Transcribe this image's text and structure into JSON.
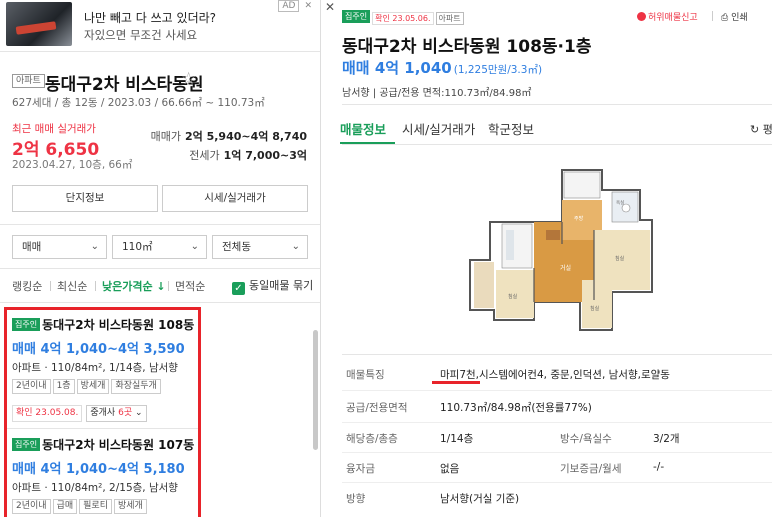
{
  "ad": {
    "line1": "나만 빼고 다 쓰고 있더라?",
    "line2": "자있으면 무조건 사세요",
    "badge": "AD",
    "close": "✕"
  },
  "complex": {
    "type": "아파트",
    "name": "동대구2차 비스타동원",
    "meta": "627세대 / 총 12동 / 2023.03 / 66.66㎡ ~ 110.73㎡",
    "recent_label": "최근 매매 실거래가",
    "recent_price": "2억 6,650",
    "recent_date": "2023.04.27, 10층, 66㎡",
    "sale_label": "매매가",
    "sale_range": "2억 5,940~4억 8,740",
    "jeonse_label": "전세가",
    "jeonse_range": "1억 7,000~3억",
    "btn_info": "단지정보",
    "btn_trade": "시세/실거래가"
  },
  "filters": {
    "deal": "매매",
    "area": "110㎡",
    "dong": "전체동"
  },
  "sort": {
    "ranking": "랭킹순",
    "newest": "최신순",
    "lowest": "낮은가격순 ↓",
    "area": "면적순",
    "group_same": "동일매물 묶기"
  },
  "listings": [
    {
      "badge": "집주인",
      "title": "동대구2차 비스타동원 108동",
      "price": "매매 4억 1,040~4억 3,590",
      "spec": "아파트 · 110/84m², 1/14층, 남서향",
      "tags": [
        "2년이내",
        "1층",
        "방세개",
        "화장실두개"
      ],
      "confirm": "확인 23.05.08.",
      "agent_label": "중개사",
      "agent_count": "6곳"
    },
    {
      "badge": "집주인",
      "title": "동대구2차 비스타동원 107동",
      "price": "매매 4억 1,040~4억 5,180",
      "spec": "아파트 · 110/84m², 2/15층, 남서향",
      "tags": [
        "2년이내",
        "급매",
        "필로티",
        "방세개"
      ]
    }
  ],
  "detail": {
    "badge_owner": "집주인",
    "badge_confirm": "확인 23.05.06.",
    "badge_type": "아파트",
    "report": "허위매물신고",
    "print": "인쇄",
    "title": "동대구2차 비스타동원 108동·1층",
    "price": "매매 4억 1,040",
    "price_per": "(1,225만원/3.3㎡)",
    "sub": "남서향 | 공급/전용 면적:110.73㎡/84.98㎡",
    "tabs": [
      "매물정보",
      "시세/실거래가",
      "학군정보"
    ],
    "refresh": "평",
    "rows": {
      "feature_label": "매물특징",
      "feature_val": "마피7천,시스템에어컨4, 중문,인덕션, 남서향,로얄동",
      "area_label": "공급/전용면적",
      "area_val": "110.73㎡/84.98㎡(전용률77%)",
      "floor_label": "해당층/총층",
      "floor_val": "1/14층",
      "rooms_label": "방수/욕실수",
      "rooms_val": "3/2개",
      "loan_label": "융자금",
      "loan_val": "없음",
      "deposit_label": "기보증금/월세",
      "deposit_val": "-/-",
      "dir_label": "방향",
      "dir_val": "남서향(거실 기준)"
    },
    "floorplan_labels": {
      "living": "거실",
      "room": "침실",
      "bath": "욕실",
      "kitchen": "주방"
    }
  },
  "colors": {
    "green": "#1a9e5a",
    "blue": "#2f7ee0",
    "red": "#e34",
    "highlight": "#e8232a"
  }
}
